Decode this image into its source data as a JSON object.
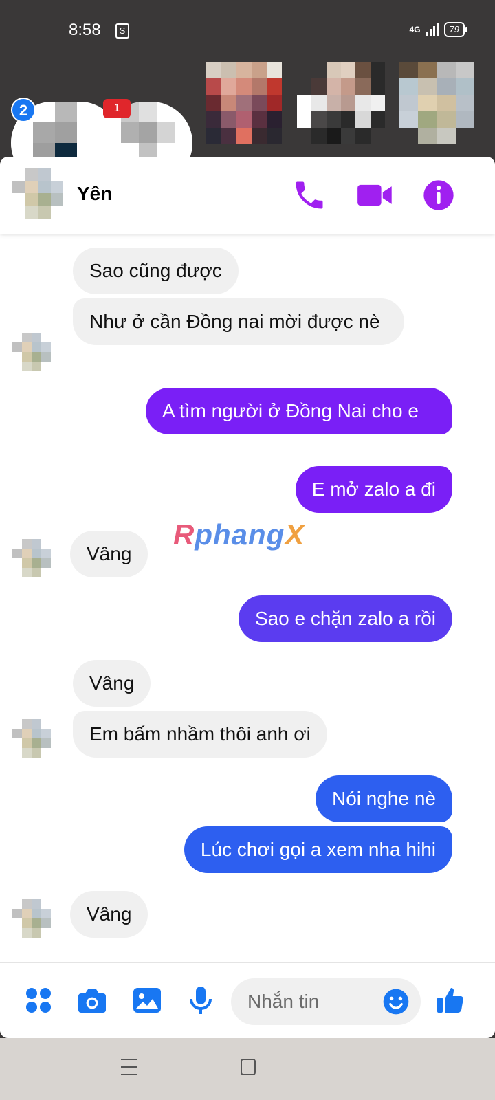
{
  "status_bar": {
    "time": "8:58",
    "shop_icon": "S",
    "network": "4G",
    "battery": "79"
  },
  "chat_heads": {
    "unread_count": "2",
    "red_badge": "1"
  },
  "header": {
    "contact_name": "Yên",
    "icons": [
      "phone-icon",
      "video-camera-icon",
      "info-icon"
    ],
    "accent_color": "#a020f0"
  },
  "messages": [
    {
      "from": "them",
      "text": "Sao cũng được"
    },
    {
      "from": "them",
      "text": "Như ở cần Đồng nai mời được nè"
    },
    {
      "from": "me",
      "text": "A tìm người ở Đồng Nai cho e"
    },
    {
      "from": "me",
      "text": "E mở zalo a đi"
    },
    {
      "from": "them",
      "text": "Vâng"
    },
    {
      "from": "me",
      "text": "Sao e chặn zalo a rồi"
    },
    {
      "from": "them",
      "text": "Vâng"
    },
    {
      "from": "them",
      "text": "Em bấm nhầm thôi anh ơi"
    },
    {
      "from": "me",
      "text": "Nói nghe nè"
    },
    {
      "from": "me",
      "text": "Lúc chơi gọi a xem nha hihi"
    },
    {
      "from": "them",
      "text": "Vâng"
    }
  ],
  "watermark": {
    "part1": "R",
    "part2": "phang",
    "part3": "X"
  },
  "composer": {
    "placeholder": "Nhắn tin",
    "icons": [
      "apps-icon",
      "camera-icon",
      "gallery-icon",
      "microphone-icon",
      "emoji-icon",
      "thumbs-up-icon"
    ],
    "accent_color": "#1877f2"
  },
  "colors": {
    "purple_bubble": "#7a1ff6",
    "violet_bubble": "#5b3cf0",
    "blue_bubble": "#2d5ff0",
    "incoming_bubble": "#f0f0f0"
  }
}
